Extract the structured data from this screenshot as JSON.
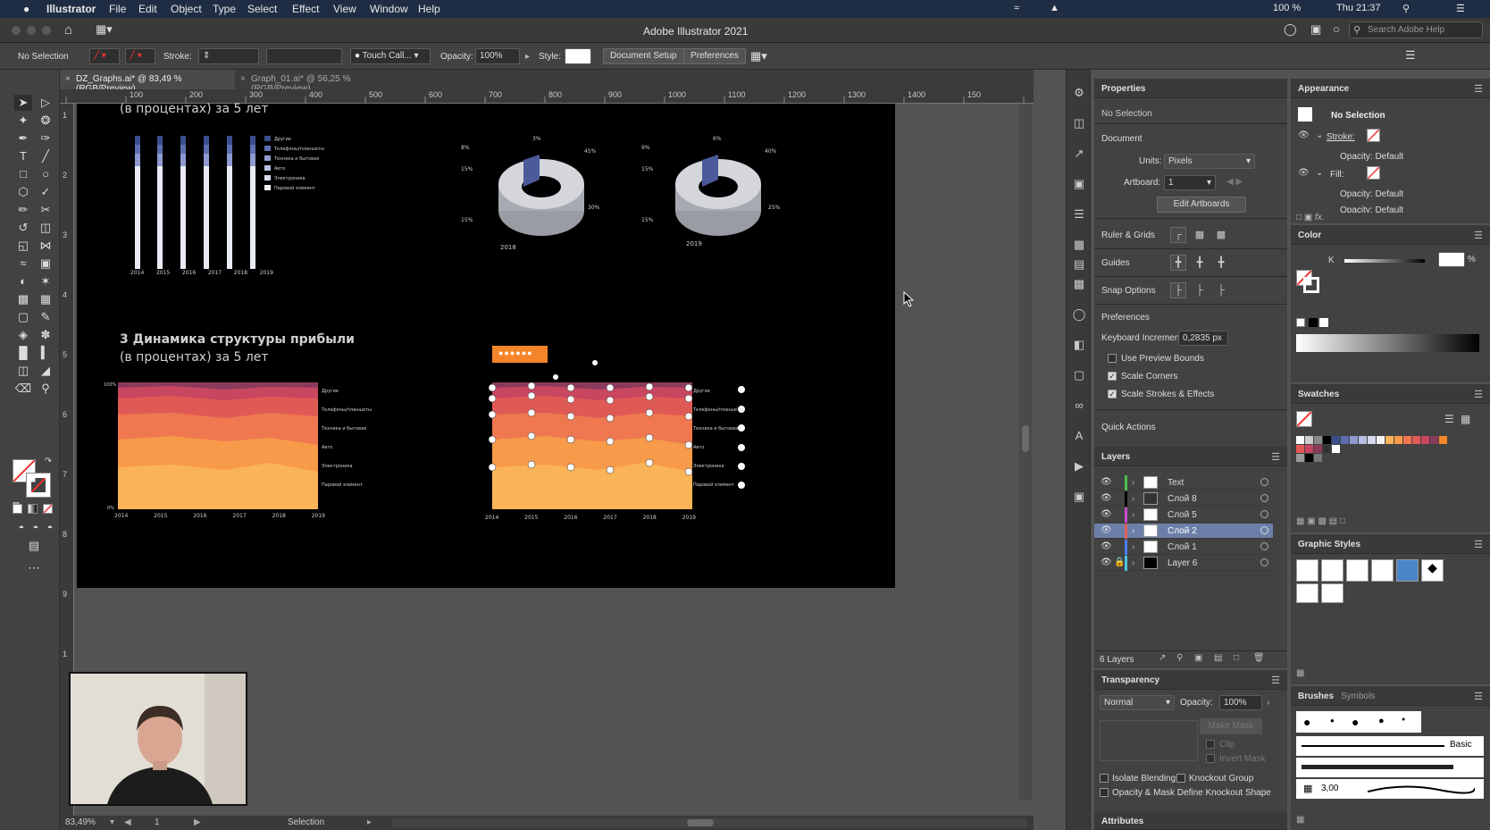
{
  "menubar": {
    "apple": "",
    "app": "Illustrator",
    "items": [
      "File",
      "Edit",
      "Object",
      "Type",
      "Select",
      "Effect",
      "View",
      "Window",
      "Help"
    ],
    "battery": "100 %",
    "clock": "Thu 21:37"
  },
  "titlebar": {
    "title": "Adobe Illustrator 2021",
    "search_placeholder": "Search Adobe Help"
  },
  "control": {
    "selection": "No Selection",
    "stroke_label": "Stroke:",
    "brush": "Touch Call...",
    "opacity_label": "Opacity:",
    "opacity": "100%",
    "style_label": "Style:",
    "document_setup": "Document Setup",
    "preferences": "Preferences"
  },
  "tabs": [
    {
      "label": "DZ_Graphs.ai* @ 83,49 % (RGB/Preview)"
    },
    {
      "label": "Graph_01.ai* @ 56,25 % (RGB/Preview)"
    }
  ],
  "ruler_h": [
    "100",
    "200",
    "300",
    "400",
    "500",
    "600",
    "700",
    "800",
    "900",
    "1000",
    "1100",
    "1200",
    "1300",
    "1400",
    "150"
  ],
  "ruler_v": [
    "1",
    "2",
    "3",
    "4",
    "5",
    "6",
    "7",
    "8",
    "9",
    "1"
  ],
  "artboard": {
    "top_subtitle": "(в процентах) за 5 лет",
    "section3_title": "3 Динамика структуры прибыли",
    "section3_subtitle": "(в процентах) за 5 лет",
    "years": [
      "2014",
      "2015",
      "2016",
      "2017",
      "2018",
      "2019"
    ],
    "legend": [
      "Другие",
      "Телефоны/планшеты",
      "Техника и бытовая",
      "Авто",
      "Электроника",
      "Паровой элемент"
    ],
    "donut1_year": "2018",
    "donut2_year": "2019",
    "donut1_labels": [
      "8%",
      "3%",
      "45%",
      "15%",
      "30%",
      "15%"
    ],
    "donut2_labels": [
      "9%",
      "6%",
      "40%",
      "15%",
      "25%",
      "15%"
    ],
    "area_y_top": "100%",
    "area_y_bottom": "0%"
  },
  "status": {
    "zoom": "83,49%",
    "artboard": "1",
    "tool": "Selection"
  },
  "properties": {
    "title": "Properties",
    "no_selection": "No Selection",
    "document": "Document",
    "units_label": "Units:",
    "units": "Pixels",
    "artboard_label": "Artboard:",
    "artboard": "1",
    "edit_artboards": "Edit Artboards",
    "ruler_grids": "Ruler & Grids",
    "guides": "Guides",
    "snap_options": "Snap Options",
    "preferences": "Preferences",
    "keyboard_increment_label": "Keyboard Increment:",
    "keyboard_increment": "0,2835 px",
    "use_preview_bounds": "Use Preview Bounds",
    "scale_corners": "Scale Corners",
    "scale_strokes": "Scale Strokes & Effects",
    "quick_actions": "Quick Actions"
  },
  "layers": {
    "title": "Layers",
    "items": [
      {
        "name": "Text",
        "color": "#4cbf4c"
      },
      {
        "name": "Слой 8",
        "color": "#000000"
      },
      {
        "name": "Слой 5",
        "color": "#c94ccf"
      },
      {
        "name": "Слой 2",
        "color": "#e06060"
      },
      {
        "name": "Слой 1",
        "color": "#4c7fff"
      },
      {
        "name": "Layer 6",
        "color": "#4cc8e0"
      }
    ],
    "count": "6 Layers"
  },
  "transparency": {
    "title": "Transparency",
    "mode": "Normal",
    "opacity_label": "Opacity:",
    "opacity": "100%",
    "make_mask": "Make Mask",
    "clip": "Clip",
    "invert_mask": "Invert Mask",
    "isolate_blending": "Isolate Blending",
    "knockout_group": "Knockout Group",
    "opacity_mask": "Opacity & Mask Define Knockout Shape"
  },
  "attributes": {
    "title": "Attributes"
  },
  "appearance": {
    "title": "Appearance",
    "no_selection": "No Selection",
    "stroke": "Stroke:",
    "opacity1": "Opacity: Default",
    "fill": "Fill:",
    "opacity2": "Opacity: Default",
    "opacity3": "Opacity: Default"
  },
  "color": {
    "title": "Color",
    "k_label": "K",
    "percent": "%"
  },
  "swatches": {
    "title": "Swatches"
  },
  "graphic_styles": {
    "title": "Graphic Styles"
  },
  "brushes": {
    "title": "Brushes",
    "symbols": "Symbols",
    "basic": "Basic",
    "size": "3,00"
  }
}
